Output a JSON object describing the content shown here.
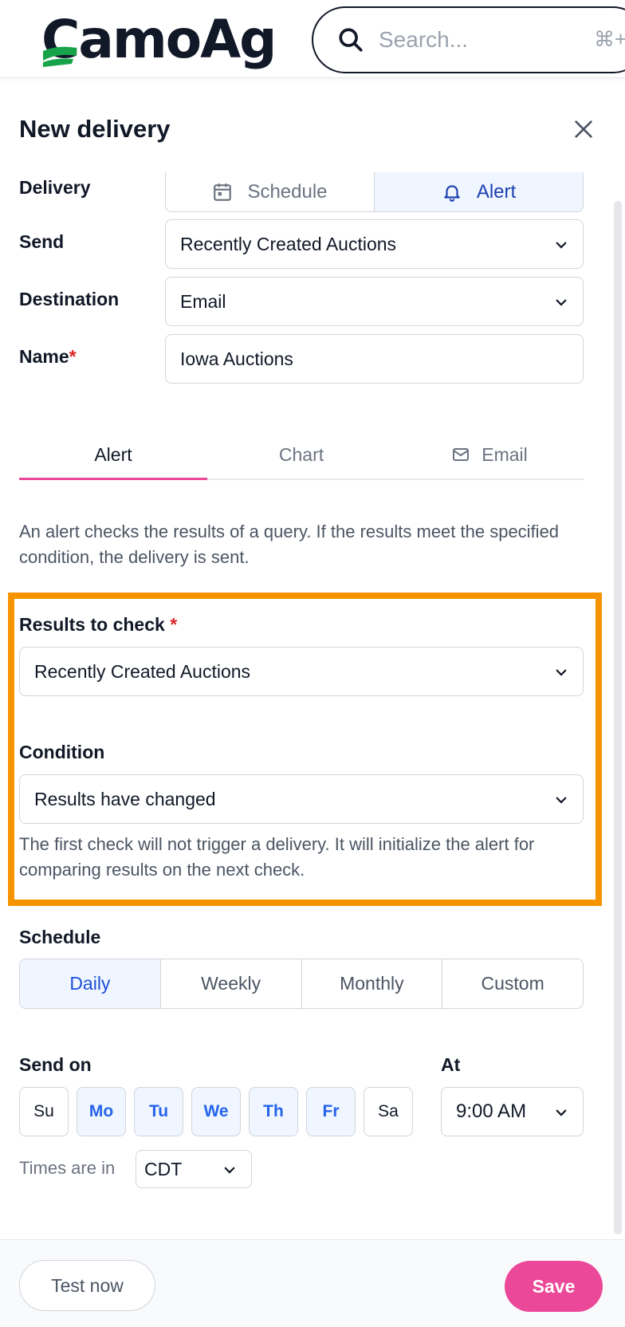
{
  "app": {
    "logo_text": "CamoAg"
  },
  "search": {
    "placeholder": "Search...",
    "shortcut": "⌘+"
  },
  "modal": {
    "title": "New delivery"
  },
  "form": {
    "delivery_label": "Delivery",
    "delivery_options": [
      "Schedule",
      "Alert"
    ],
    "send_label": "Send",
    "send_value": "Recently Created Auctions",
    "destination_label": "Destination",
    "destination_value": "Email",
    "name_label": "Name",
    "required_mark": "*",
    "name_value": "Iowa Auctions"
  },
  "tabs": [
    "Alert",
    "Chart",
    "Email"
  ],
  "alert": {
    "description": "An alert checks the results of a query. If the results meet the specified condition, the delivery is sent.",
    "results_label": "Results to check",
    "results_value": "Recently Created Auctions",
    "condition_label": "Condition",
    "condition_value": "Results have changed",
    "condition_help": "The first check will not trigger a delivery. It will initialize the alert for comparing results on the next check."
  },
  "schedule": {
    "label": "Schedule",
    "options": [
      "Daily",
      "Weekly",
      "Monthly",
      "Custom"
    ],
    "send_on_label": "Send on",
    "days": [
      "Su",
      "Mo",
      "Tu",
      "We",
      "Th",
      "Fr",
      "Sa"
    ],
    "at_label": "At",
    "time_value": "9:00 AM",
    "tz_label": "Times are in",
    "tz_value": "CDT"
  },
  "footer": {
    "test_label": "Test now",
    "save_label": "Save"
  },
  "colors": {
    "accent": "#ec4899",
    "highlight": "#f59300",
    "active_blue": "#2563eb"
  }
}
